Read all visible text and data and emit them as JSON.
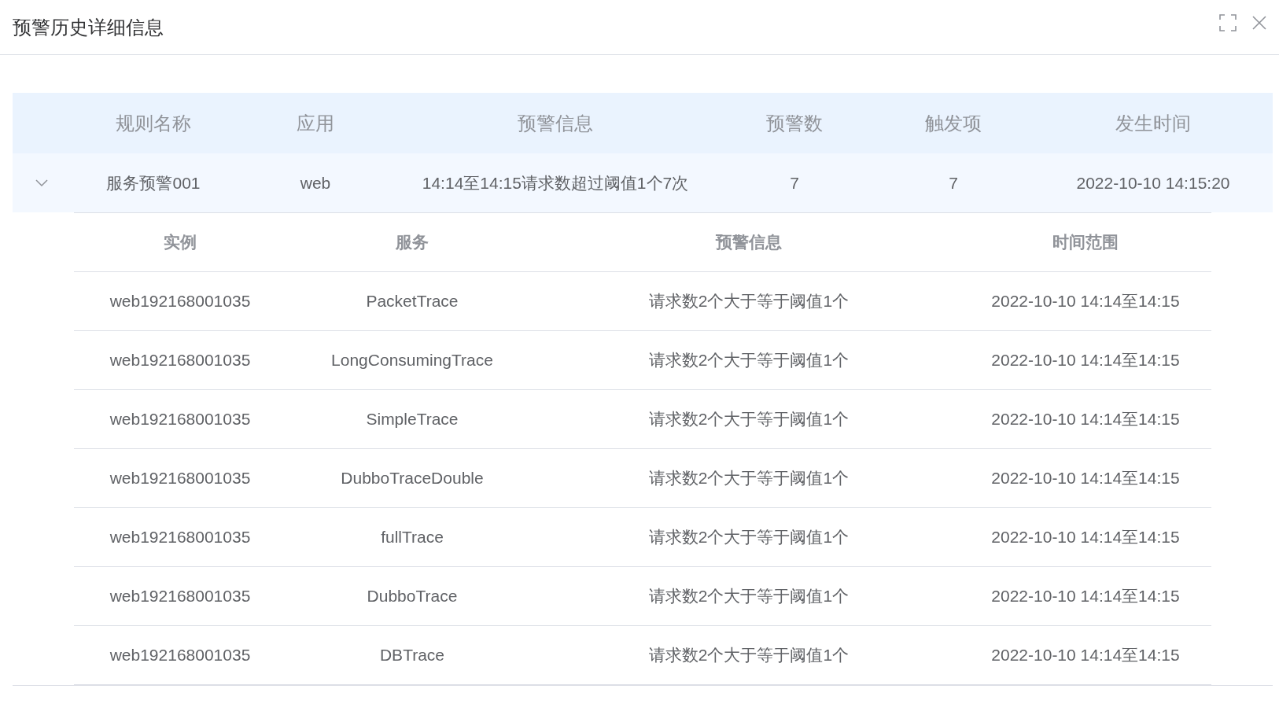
{
  "dialog": {
    "title": "预警历史详细信息"
  },
  "table": {
    "columns": [
      "规则名称",
      "应用",
      "预警信息",
      "预警数",
      "触发项",
      "发生时间"
    ],
    "rows": [
      {
        "expanded": true,
        "cells": [
          "服务预警001",
          "web",
          "14:14至14:15请求数超过阈值1个7次",
          "7",
          "7",
          "2022-10-10 14:15:20"
        ],
        "detail": {
          "columns": [
            "实例",
            "服务",
            "预警信息",
            "时间范围"
          ],
          "rows": [
            [
              "web192168001035",
              "PacketTrace",
              "请求数2个大于等于阈值1个",
              "2022-10-10 14:14至14:15"
            ],
            [
              "web192168001035",
              "LongConsumingTrace",
              "请求数2个大于等于阈值1个",
              "2022-10-10 14:14至14:15"
            ],
            [
              "web192168001035",
              "SimpleTrace",
              "请求数2个大于等于阈值1个",
              "2022-10-10 14:14至14:15"
            ],
            [
              "web192168001035",
              "DubboTraceDouble",
              "请求数2个大于等于阈值1个",
              "2022-10-10 14:14至14:15"
            ],
            [
              "web192168001035",
              "fullTrace",
              "请求数2个大于等于阈值1个",
              "2022-10-10 14:14至14:15"
            ],
            [
              "web192168001035",
              "DubboTrace",
              "请求数2个大于等于阈值1个",
              "2022-10-10 14:14至14:15"
            ],
            [
              "web192168001035",
              "DBTrace",
              "请求数2个大于等于阈值1个",
              "2022-10-10 14:14至14:15"
            ]
          ]
        }
      }
    ]
  }
}
